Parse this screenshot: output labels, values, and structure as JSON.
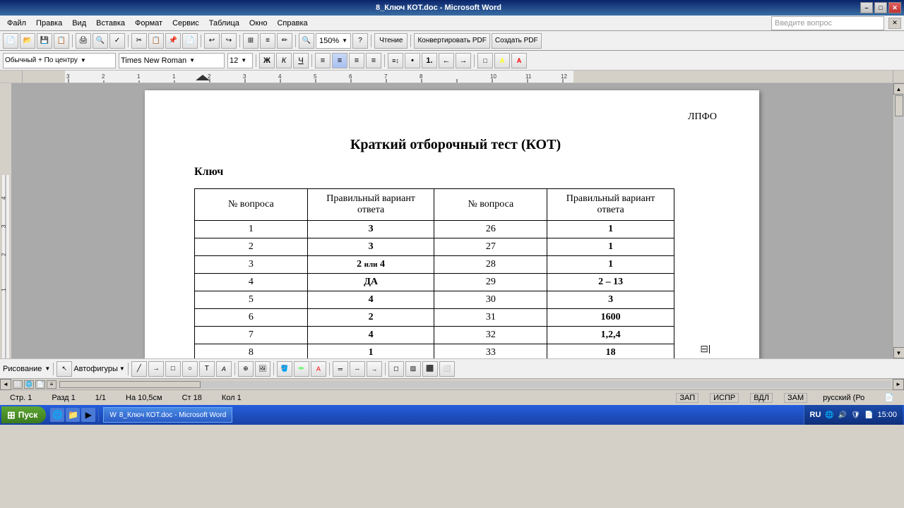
{
  "titleBar": {
    "title": "8_Ключ КОТ.doc - Microsoft Word",
    "minBtn": "–",
    "maxBtn": "□",
    "closeBtn": "✕"
  },
  "menuBar": {
    "items": [
      "Файл",
      "Правка",
      "Вид",
      "Вставка",
      "Формат",
      "Сервис",
      "Таблица",
      "Окно",
      "Справка"
    ]
  },
  "formatBar": {
    "style": "Обычный + По центру",
    "font": "Times New Roman",
    "size": "12",
    "bold": "Ж",
    "italic": "К",
    "underline": "Ч"
  },
  "toolbar": {
    "zoom": "150%",
    "readMode": "Чтение",
    "convertPdf": "Конвертировать PDF",
    "createPdf": "Создать PDF"
  },
  "document": {
    "headerRight": "ЛПФО",
    "title": "Краткий отборочный тест (КОТ)",
    "subtitle": "Ключ",
    "table": {
      "headers": [
        "№ вопроса",
        "Правильный вариант ответа",
        "№ вопроса",
        "Правильный вариант ответа"
      ],
      "rows": [
        [
          "1",
          "3",
          "26",
          "1"
        ],
        [
          "2",
          "3",
          "27",
          "1"
        ],
        [
          "3",
          "2 или 4",
          "28",
          "1"
        ],
        [
          "4",
          "ДА",
          "29",
          "2 – 13"
        ],
        [
          "5",
          "4",
          "30",
          "3"
        ],
        [
          "6",
          "2",
          "31",
          "1600"
        ],
        [
          "7",
          "4",
          "32",
          "1,2,4"
        ],
        [
          "8",
          "1",
          "33",
          "18"
        ]
      ]
    }
  },
  "statusBar": {
    "page": "Стр. 1",
    "section": "Разд 1",
    "pageOf": "1/1",
    "position": "На 10,5см",
    "line": "Ст 18",
    "col": "Кол 1",
    "lang": "русский (Ро"
  },
  "taskbar": {
    "startLabel": "Пуск",
    "time": "15:00",
    "activeWindow": "8_Ключ КОТ.doc - Microsoft Word",
    "inputLang": "RU"
  },
  "questionInput": {
    "placeholder": "Введите вопрос"
  },
  "bottomDrawing": {
    "label": "Рисование",
    "autoShapes": "Автофигуры"
  }
}
